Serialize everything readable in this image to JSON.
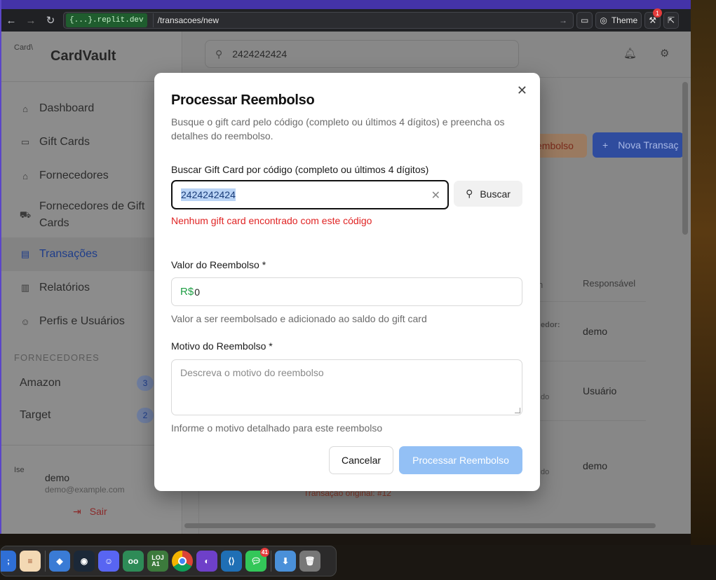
{
  "browser": {
    "host": "{...}.replit.dev",
    "path": "/transacoes/new",
    "theme_label": "Theme",
    "notification_count": "1"
  },
  "sidebar": {
    "brand": "CardVault",
    "logo_alt": "Card\\",
    "items": [
      {
        "label": "Dashboard",
        "icon": "home-icon"
      },
      {
        "label": "Gift Cards",
        "icon": "card-icon"
      },
      {
        "label": "Fornecedores",
        "icon": "store-icon"
      },
      {
        "label": "Fornecedores de Gift Cards",
        "icon": "cart-icon"
      },
      {
        "label": "Transações",
        "icon": "receipt-icon"
      },
      {
        "label": "Relatórios",
        "icon": "chart-icon"
      },
      {
        "label": "Perfis e Usuários",
        "icon": "users-icon"
      }
    ],
    "section_title": "FORNECEDORES",
    "suppliers": [
      {
        "name": "Amazon",
        "count": "3"
      },
      {
        "name": "Target",
        "count": "2"
      }
    ],
    "user": {
      "name": "demo",
      "email": "demo@example.com",
      "avatar_alt": "Ise",
      "logout": "Sair"
    }
  },
  "header": {
    "search_value": "2424242424"
  },
  "background": {
    "refund_button": "embolso",
    "new_button": "Nova Transaç",
    "column_header": "Responsável",
    "col_h_partial": "n",
    "rows": [
      {
        "responsible": "demo",
        "partial": "edor:"
      },
      {
        "responsible": "Usuário",
        "partial": "do"
      },
      {
        "responsible": "demo",
        "partial": "do"
      }
    ],
    "original_txn": "Transação original: #12"
  },
  "modal": {
    "title": "Processar Reembolso",
    "description": "Busque o gift card pelo código (completo ou últimos 4 dígitos) e preencha os detalhes do reembolso.",
    "search_label": "Buscar Gift Card por código (completo ou últimos 4 dígitos)",
    "search_value": "2424242424",
    "search_button": "Buscar",
    "error": "Nenhum gift card encontrado com este código",
    "amount_label": "Valor do Reembolso *",
    "currency": "R$",
    "amount_value": "0",
    "amount_hint": "Valor a ser reembolsado e adicionado ao saldo do gift card",
    "reason_label": "Motivo do Reembolso *",
    "reason_placeholder": "Descreva o motivo do reembolso",
    "reason_hint": "Informe o motivo detalhado para este reembolso",
    "cancel": "Cancelar",
    "submit": "Processar Reembolso"
  },
  "dock": {
    "messages_badge": "41",
    "apps": [
      "finder-icon",
      "notes-icon",
      "appstore-icon",
      "steam-icon",
      "discord-icon",
      "goodreads-icon",
      "loja-icon",
      "chrome-icon",
      "github-icon",
      "vscode-icon",
      "messages-icon",
      "downloads-icon",
      "trash-icon"
    ],
    "labels": {
      "loja": "LOJ\nA1"
    }
  }
}
